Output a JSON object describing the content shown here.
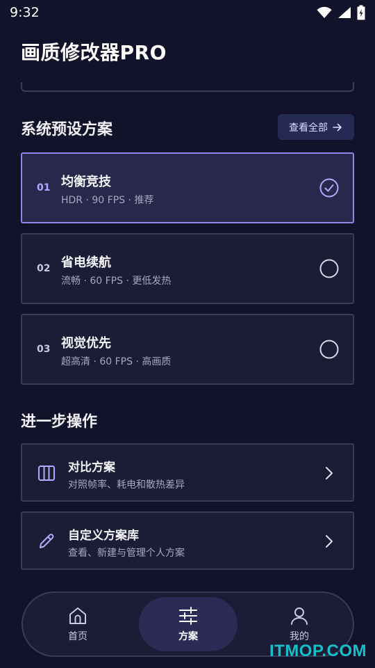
{
  "status_bar": {
    "time": "9:32"
  },
  "app": {
    "title": "画质修改器PRO"
  },
  "presets_section": {
    "title": "系统预设方案",
    "view_all_label": "查看全部",
    "items": [
      {
        "num": "01",
        "name": "均衡竞技",
        "desc": "HDR · 90 FPS · 推荐",
        "selected": true
      },
      {
        "num": "02",
        "name": "省电续航",
        "desc": "流畅 · 60 FPS · 更低发热",
        "selected": false
      },
      {
        "num": "03",
        "name": "视觉优先",
        "desc": "超高清 · 60 FPS · 高画质",
        "selected": false
      }
    ]
  },
  "actions_section": {
    "title": "进一步操作",
    "items": [
      {
        "name": "对比方案",
        "desc": "对照帧率、耗电和散热差异",
        "icon": "columns-icon"
      },
      {
        "name": "自定义方案库",
        "desc": "查看、新建与管理个人方案",
        "icon": "pencil-icon"
      }
    ]
  },
  "bottom_nav": {
    "items": [
      {
        "label": "首页",
        "icon": "home-icon",
        "active": false
      },
      {
        "label": "方案",
        "icon": "sliders-icon",
        "active": true
      },
      {
        "label": "我的",
        "icon": "user-icon",
        "active": false
      }
    ]
  },
  "watermark": "ITMOP.COM",
  "colors": {
    "background": "#12132a",
    "card": "#1b1c35",
    "card_selected": "#28284d",
    "accent": "#8e86e8",
    "watermark": "#16c0c8"
  }
}
